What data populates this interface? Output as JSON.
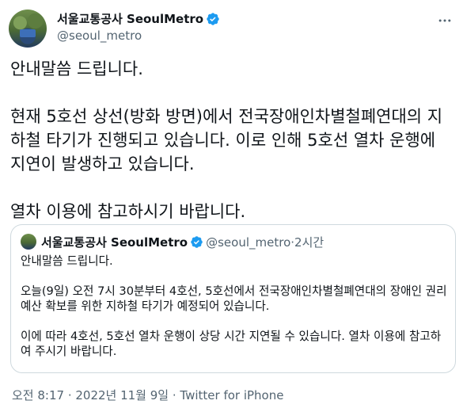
{
  "author": {
    "display_name": "서울교통공사 SeoulMetro",
    "handle": "@seoul_metro"
  },
  "tweet": {
    "text": "안내말씀 드립니다.\n\n현재 5호선 상선(방화 방면)에서 전국장애인차별철폐연대의 지하철 타기가 진행되고 있습니다. 이로 인해 5호선 열차 운행에 지연이 발생하고 있습니다.\n\n열차 이용에 참고하시기 바랍니다."
  },
  "quote": {
    "display_name": "서울교통공사 SeoulMetro",
    "handle": "@seoul_metro",
    "separator": "·",
    "time": "2시간",
    "text": "안내말씀 드립니다.\n\n오늘(9일) 오전 7시 30분부터 4호선, 5호선에서 전국장애인차별철폐연대의 장애인 권리예산 확보를 위한 지하철 타기가 예정되어 있습니다.\n\n이에 따라 4호선, 5호선 열차 운행이 상당 시간 지연될 수 있습니다. 열차 이용에 참고하여 주시기 바랍니다."
  },
  "meta": {
    "timestamp": "오전 8:17 · 2022년 11월 9일 · Twitter for iPhone"
  },
  "icons": {
    "verified": "verified-badge-icon",
    "more": "more-options-icon"
  },
  "colors": {
    "verified": "#1d9bf0",
    "secondary_text": "#536471",
    "border": "#cfd9de"
  }
}
